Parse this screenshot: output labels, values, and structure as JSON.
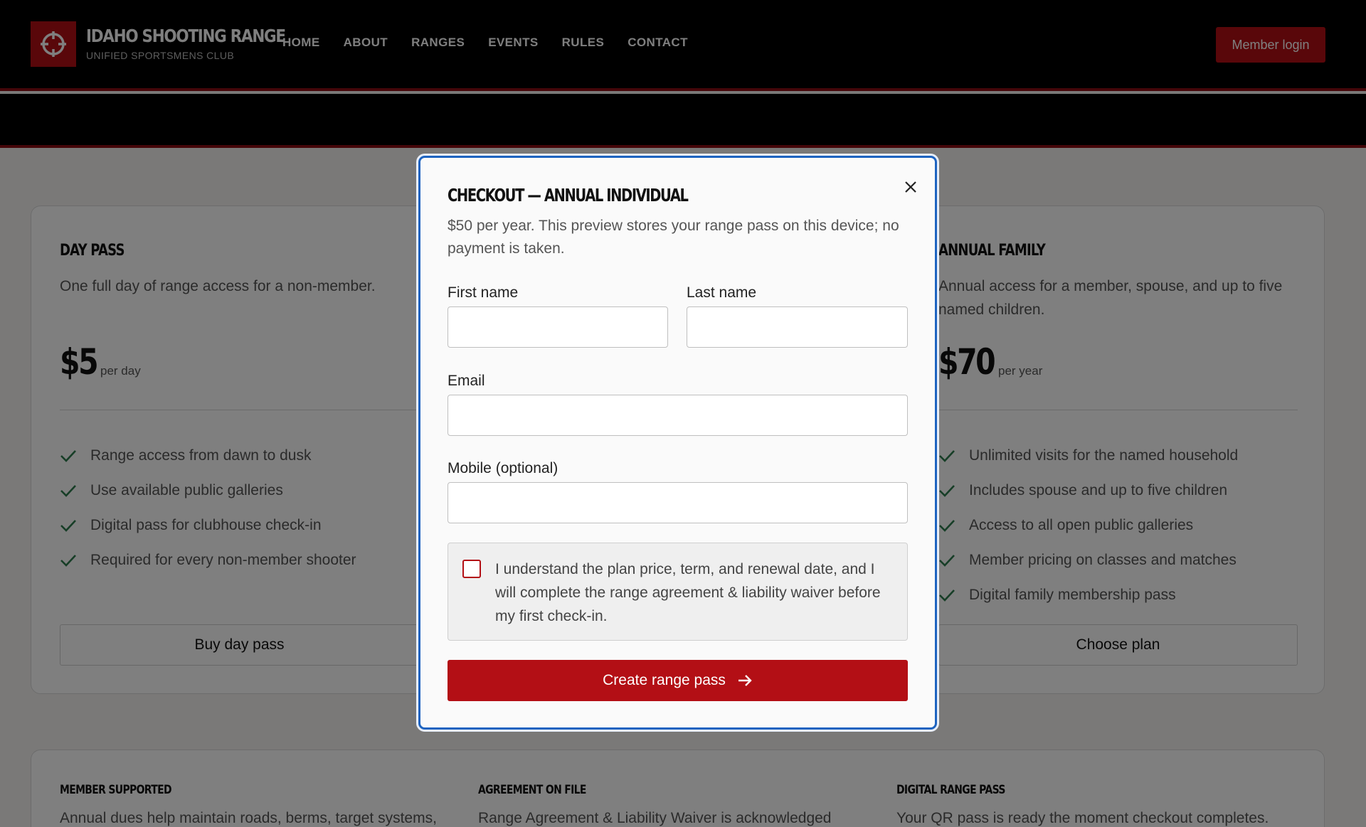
{
  "header": {
    "brand_title": "IDAHO SHOOTING RANGE",
    "brand_subtitle": "UNIFIED SPORTSMENS CLUB",
    "logo_icon": "crosshair-icon",
    "nav": [
      {
        "label": "HOME"
      },
      {
        "label": "ABOUT"
      },
      {
        "label": "RANGES"
      },
      {
        "label": "EVENTS"
      },
      {
        "label": "RULES"
      },
      {
        "label": "CONTACT"
      }
    ],
    "login_label": "Member login"
  },
  "plans": [
    {
      "title": "DAY PASS",
      "description": "One full day of range access for a non-member.",
      "price": "$5",
      "unit": "per day",
      "features": [
        "Range access from dawn to dusk",
        "Use available public galleries",
        "Digital pass for clubhouse check-in",
        "Required for every non-member shooter"
      ],
      "button": "Buy day pass"
    },
    {
      "title": "ANNUAL FAMILY",
      "description": "Annual access for a member, spouse, and up to five named children.",
      "price": "$70",
      "unit": "per year",
      "features": [
        "Unlimited visits for the named household",
        "Includes spouse and up to five children",
        "Access to all open public galleries",
        "Member pricing on classes and matches",
        "Digital family membership pass"
      ],
      "button": "Choose plan"
    }
  ],
  "info": [
    {
      "title": "MEMBER SUPPORTED",
      "text": "Annual dues help maintain roads, berms, target systems,"
    },
    {
      "title": "AGREEMENT ON FILE",
      "text": "Range Agreement & Liability Waiver is acknowledged"
    },
    {
      "title": "DIGITAL RANGE PASS",
      "text": "Your QR pass is ready the moment checkout completes."
    }
  ],
  "modal": {
    "title": "CHECKOUT — ANNUAL INDIVIDUAL",
    "description": "$50 per year. This preview stores your range pass on this device; no payment is taken.",
    "first_name_label": "First name",
    "first_name_value": "",
    "last_name_label": "Last name",
    "last_name_value": "",
    "email_label": "Email",
    "email_value": "",
    "mobile_label": "Mobile (optional)",
    "mobile_value": "",
    "consent_text": "I understand the plan price, term, and renewal date, and I will complete the range agreement & liability waiver before my first check-in.",
    "consent_checked": false,
    "submit_label": "Create range pass",
    "close_icon": "close-icon",
    "submit_icon": "arrow-right-icon"
  },
  "colors": {
    "accent": "#b30f15",
    "focus_border": "#1d63c0",
    "header_bg": "#000000"
  }
}
